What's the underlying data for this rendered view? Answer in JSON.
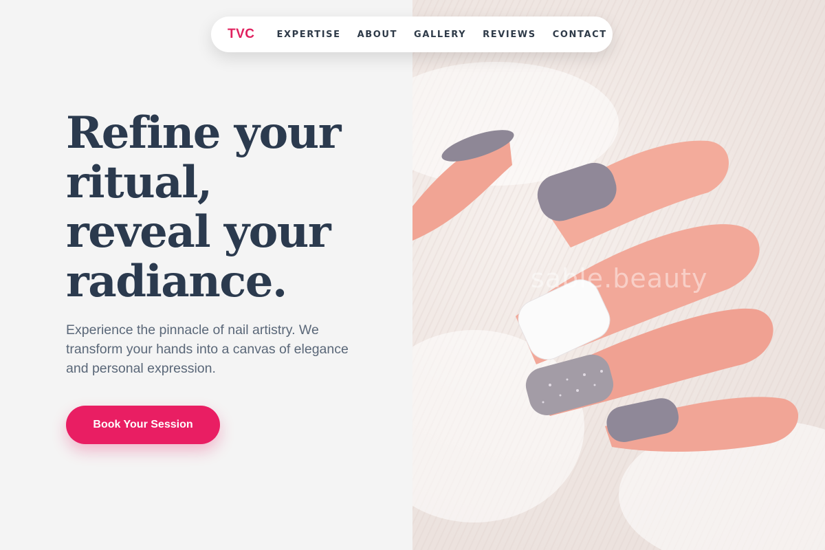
{
  "nav": {
    "brand": "TVC",
    "links": [
      "EXPERTISE",
      "ABOUT",
      "GALLERY",
      "REVIEWS",
      "CONTACT"
    ]
  },
  "hero": {
    "headline_lines": [
      "Refine your",
      "ritual,",
      "reveal your",
      "radiance."
    ],
    "subtext": "Experience the pinnacle of nail artistry. We transform your hands into a canvas of elegance and personal expression.",
    "cta_label": "Book Your Session",
    "image": {
      "subject": "manicured-hand-on-knit-sweater",
      "watermark": "sable.beauty"
    }
  },
  "colors": {
    "accent": "#e91e63",
    "heading": "#2b3a4e",
    "body_text": "#5a6778",
    "background": "#f4f4f4",
    "nail_lilac": "#8e8796",
    "nail_white": "#ffffff",
    "nail_glitter": "#9e98a2"
  }
}
